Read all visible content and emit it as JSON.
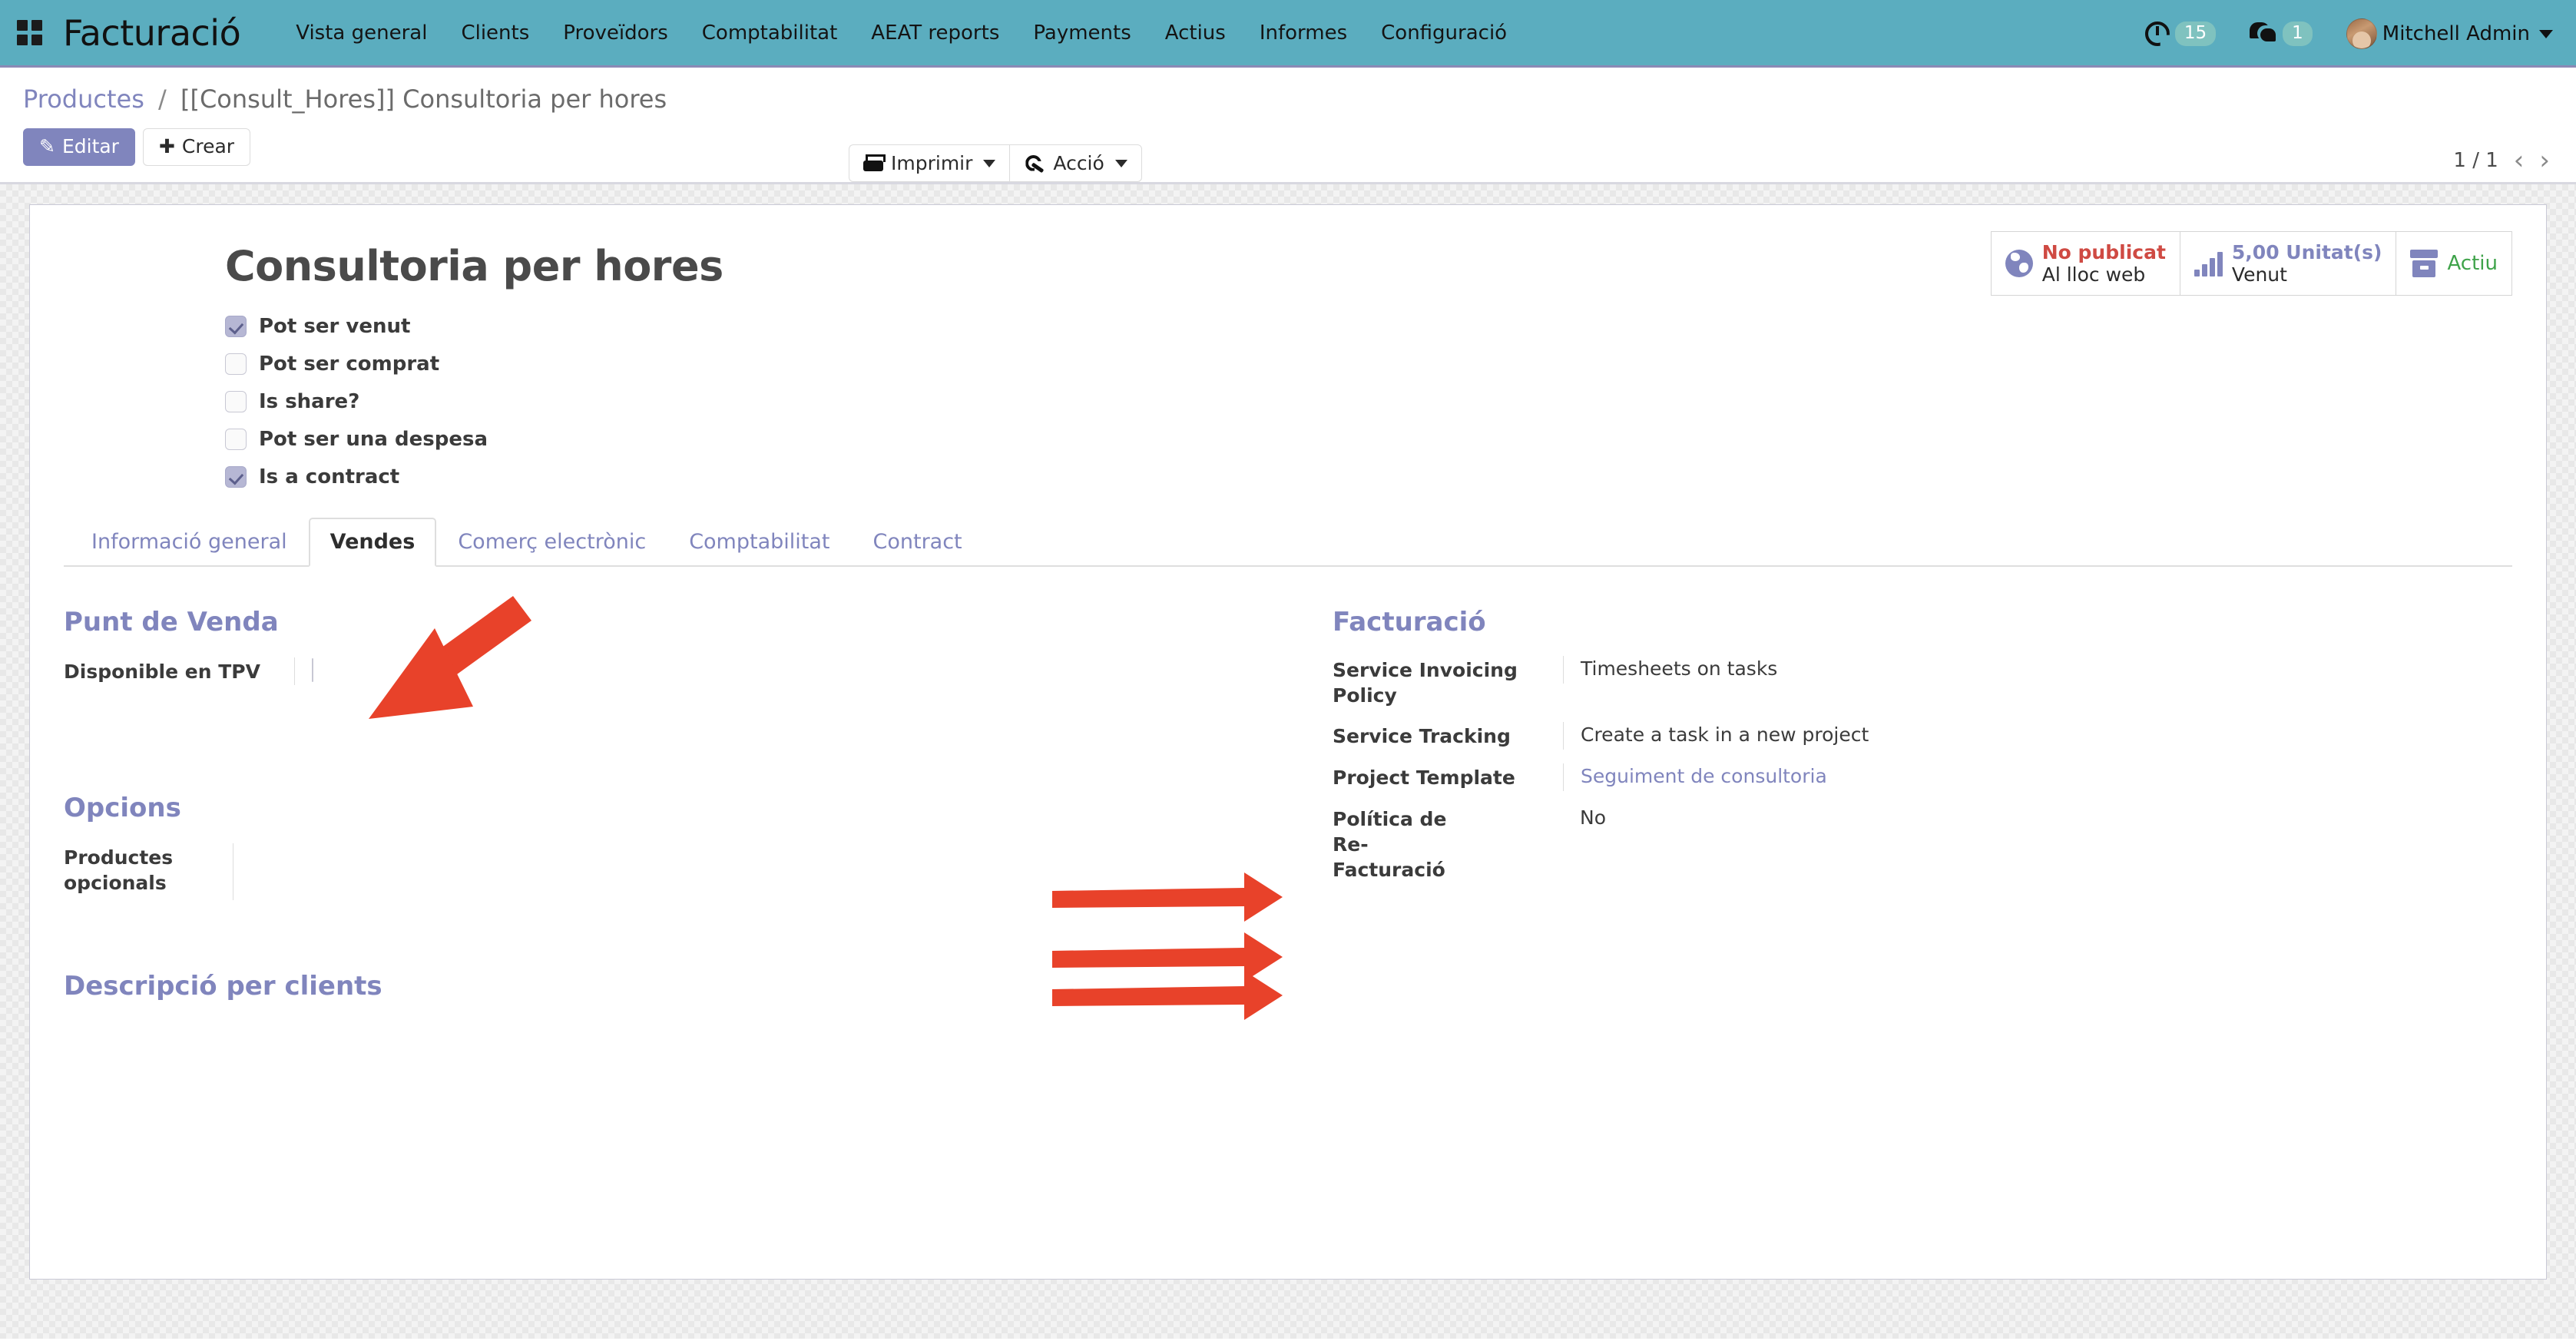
{
  "navbar": {
    "apps_icon": "grid-apps-icon",
    "brand": "Facturació",
    "menu": [
      {
        "label": "Vista general"
      },
      {
        "label": "Clients"
      },
      {
        "label": "Proveïdors"
      },
      {
        "label": "Comptabilitat"
      },
      {
        "label": "AEAT reports"
      },
      {
        "label": "Payments"
      },
      {
        "label": "Actius"
      },
      {
        "label": "Informes"
      },
      {
        "label": "Configuració"
      }
    ],
    "activities_icon": "clock-icon",
    "activities_count": "15",
    "messages_icon": "chat-bubble-icon",
    "messages_count": "1",
    "avatar_icon": "user-avatar",
    "user_name": "Mitchell Admin",
    "user_caret_icon": "chevron-down-icon"
  },
  "control_panel": {
    "breadcrumb_root": "Productes",
    "breadcrumb_sep": "/",
    "breadcrumb_current": "[[Consult_Hores]] Consultoria per hores",
    "edit_label": "Editar",
    "edit_icon": "pencil-icon",
    "create_label": "Crear",
    "create_icon": "plus-icon",
    "print_label": "Imprimir",
    "print_icon": "printer-icon",
    "action_label": "Acció",
    "action_icon": "wrench-icon",
    "pager_value": "1 / 1",
    "pager_prev_icon": "chevron-left-icon",
    "pager_next_icon": "chevron-right-icon"
  },
  "form": {
    "title": "Consultoria per hores",
    "checkboxes": [
      {
        "label": "Pot ser venut",
        "checked": true
      },
      {
        "label": "Pot ser comprat",
        "checked": false
      },
      {
        "label": "Is share?",
        "checked": false
      },
      {
        "label": "Pot ser una despesa",
        "checked": false
      },
      {
        "label": "Is a contract",
        "checked": true
      }
    ],
    "stat_buttons": [
      {
        "icon": "globe-icon",
        "line1": "No publicat",
        "line2": "Al lloc web",
        "line1_color": "#cf4a43"
      },
      {
        "icon": "bar-chart-icon",
        "line1": "5,00 Unitat(s)",
        "line2": "Venut",
        "line1_color": "#8085bd"
      },
      {
        "icon": "archive-box-icon",
        "line1": "Actiu",
        "line2": "",
        "line1_color": "#3fa34a"
      }
    ],
    "tabs": [
      {
        "label": "Informació general",
        "active": false
      },
      {
        "label": "Vendes",
        "active": true
      },
      {
        "label": "Comerç electrònic",
        "active": false
      },
      {
        "label": "Comptabilitat",
        "active": false
      },
      {
        "label": "Contract",
        "active": false
      }
    ],
    "left": {
      "group_title": "Punt de Venda",
      "pos_available_label": "Disponible en TPV",
      "pos_available_checked": false,
      "options_title": "Opcions",
      "optional_products_label": "Productes opcionals",
      "optional_products_value": "",
      "description_title": "Descripció per clients"
    },
    "right": {
      "group_title": "Facturació",
      "fields": [
        {
          "label": "Service Invoicing Policy",
          "value": "Timesheets on tasks",
          "is_link": false
        },
        {
          "label": "Service Tracking",
          "value": "Create a task in a new project",
          "is_link": false
        },
        {
          "label": "Project Template",
          "value": "Seguiment de consultoria",
          "is_link": true
        },
        {
          "label": "Política de Re-Facturació",
          "value": "No",
          "is_link": false
        }
      ]
    }
  },
  "annotations": {
    "arrow_color": "#e8422a",
    "arrows": [
      {
        "name": "arrow-to-vendes-tab",
        "direction": "down-left"
      },
      {
        "name": "arrow-to-service-invoicing-policy",
        "direction": "right"
      },
      {
        "name": "arrow-to-service-tracking",
        "direction": "right"
      },
      {
        "name": "arrow-to-project-template",
        "direction": "right"
      }
    ]
  }
}
